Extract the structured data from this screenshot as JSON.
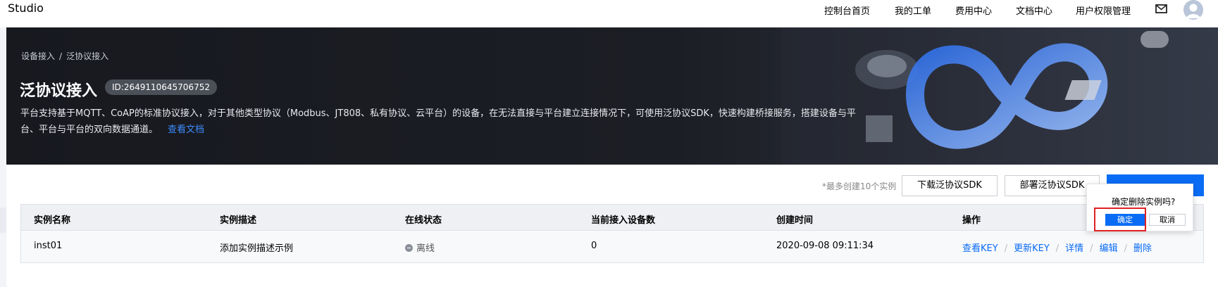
{
  "header": {
    "brand": "Studio",
    "nav": [
      "控制台首页",
      "我的工单",
      "费用中心",
      "文档中心",
      "用户权限管理"
    ],
    "icons": [
      "mail-icon",
      "avatar"
    ]
  },
  "banner": {
    "breadcrumb": [
      "设备接入",
      "泛协议接入"
    ],
    "breadcrumb_separator": "/",
    "title": "泛协议接入",
    "id_badge": "ID:2649110645706752",
    "description": "平台支持基于MQTT、CoAP的标准协议接入，对于其他类型协议（Modbus、JT808、私有协议、云平台）的设备，在无法直接与平台建立连接情况下，可使用泛协议SDK，快速构建桥接服务，搭建设备与平台、平台与平台的双向数据通道。",
    "doc_link": "查看文档"
  },
  "actions": {
    "hint": "*最多创建10个实例",
    "download_sdk": "下载泛协议SDK",
    "deploy_sdk": "部署泛协议SDK"
  },
  "table": {
    "columns": [
      "实例名称",
      "实例描述",
      "在线状态",
      "当前接入设备数",
      "创建时间",
      "操作"
    ],
    "rows": [
      {
        "name": "inst01",
        "description": "添加实例描述示例",
        "status": "离线",
        "device_count": "0",
        "created": "2020-09-08 09:11:34",
        "operations": [
          "查看KEY",
          "更新KEY",
          "详情",
          "编辑",
          "删除"
        ]
      }
    ]
  },
  "popconfirm": {
    "title": "确定删除实例吗?",
    "ok": "确定",
    "cancel": "取消"
  },
  "colors": {
    "primary": "#0a6cf5",
    "banner_bg": "#17191f",
    "highlight": "#e02020"
  }
}
